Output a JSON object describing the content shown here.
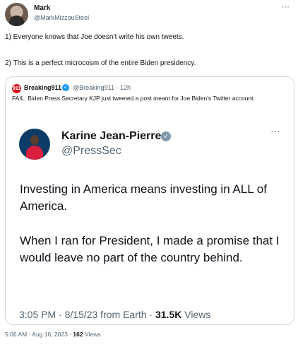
{
  "author": {
    "name": "Mark",
    "handle": "@MarkMizzouSteel",
    "more_icon": "more-horizontal-icon"
  },
  "tweet": {
    "line1": "1) Everyone knows that Joe doesn’t write his own tweets.",
    "line2": "2) This is a perfect microcosm of the entire Biden presidency."
  },
  "quote": {
    "avatar_text": "911",
    "name": "Breaking911",
    "handle_time": "@Breaking911 · 12h",
    "text": "FAIL: Biden Press Secretary KJP just tweeted a post meant for Joe Biden's Twitter account.",
    "inner": {
      "name": "Karine Jean-Pierre",
      "handle": "@PressSec",
      "paragraph1": "Investing in America means investing in ALL of America.",
      "paragraph2": "When I ran for President, I made a promise that I would leave no part of the country behind.",
      "meta_time": "3:05 PM · 8/15/23 from Earth · ",
      "meta_views_count": "31.5K",
      "meta_views_label": " Views"
    }
  },
  "footer": {
    "time": "5:06 AM · Aug 16, 2023 · ",
    "views_count": "162",
    "views_label": " Views"
  },
  "colors": {
    "text": "#0f1419",
    "secondary": "#536471",
    "border": "#cfd9de",
    "verified_blue": "#1d9bf0",
    "verified_gray": "#829aab"
  }
}
